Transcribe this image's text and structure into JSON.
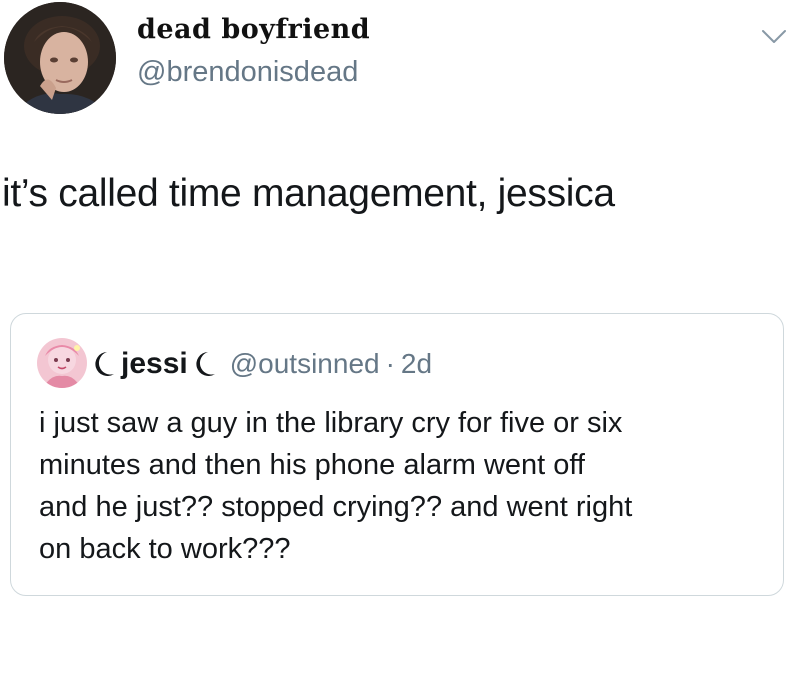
{
  "tweet": {
    "author": {
      "display_name": "dead boyfriend",
      "handle": "@brendonisdead",
      "avatar_icon": "profile-photo"
    },
    "menu_icon": "chevron-down-icon",
    "text": "it’s called time management, jessica"
  },
  "quoted_tweet": {
    "author": {
      "display_name": "jessi",
      "name_prefix_icon": "crescent-moon-icon",
      "name_suffix_icon": "crescent-moon-icon",
      "handle": "@outsinned",
      "separator": "·",
      "time": "2d",
      "avatar_icon": "profile-photo"
    },
    "text_lines": [
      "i just saw a guy in the library cry for five or six",
      "minutes and then his phone alarm went off",
      "and he just?? stopped crying?? and went right",
      "on back to work???"
    ]
  },
  "colors": {
    "text": "#14171a",
    "secondary": "#657786",
    "border": "#cfd8dc",
    "background": "#ffffff"
  }
}
